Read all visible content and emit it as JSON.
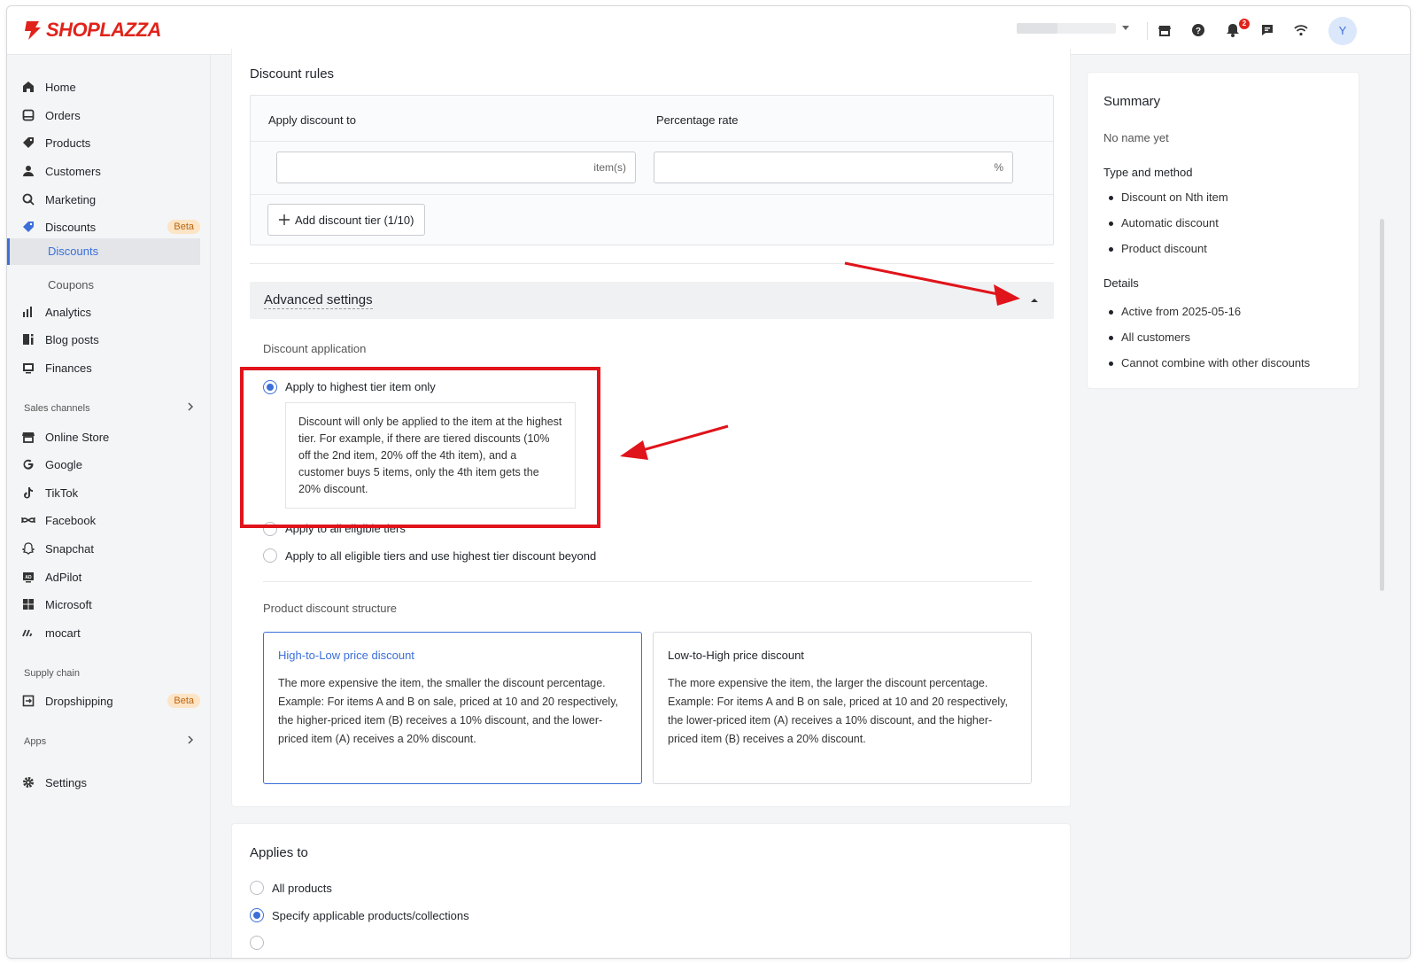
{
  "brand": {
    "name": "SHOPLAZZA",
    "color": "#e0231b",
    "accent": "#3c6fd9"
  },
  "topbar": {
    "notification_count": "2",
    "avatar_initial": "Y"
  },
  "sidebar": {
    "items": [
      {
        "label": "Home",
        "icon": "home-icon"
      },
      {
        "label": "Orders",
        "icon": "orders-icon"
      },
      {
        "label": "Products",
        "icon": "tag-icon"
      },
      {
        "label": "Customers",
        "icon": "person-icon"
      },
      {
        "label": "Marketing",
        "icon": "marketing-icon"
      },
      {
        "label": "Discounts",
        "icon": "discount-icon",
        "badge": "Beta"
      },
      {
        "label": "Analytics",
        "icon": "analytics-icon"
      },
      {
        "label": "Blog posts",
        "icon": "blog-icon"
      },
      {
        "label": "Finances",
        "icon": "finances-icon"
      }
    ],
    "sub_items": [
      "Discounts",
      "Coupons"
    ],
    "sales_channels_label": "Sales channels",
    "channels": [
      {
        "label": "Online Store",
        "icon": "store-icon"
      },
      {
        "label": "Google",
        "icon": "google-icon"
      },
      {
        "label": "TikTok",
        "icon": "tiktok-icon"
      },
      {
        "label": "Facebook",
        "icon": "facebook-icon"
      },
      {
        "label": "Snapchat",
        "icon": "snapchat-icon"
      },
      {
        "label": "AdPilot",
        "icon": "adpilot-icon"
      },
      {
        "label": "Microsoft",
        "icon": "microsoft-icon"
      },
      {
        "label": "mocart",
        "icon": "mocart-icon"
      }
    ],
    "supply_chain_label": "Supply chain",
    "dropshipping": {
      "label": "Dropshipping",
      "badge": "Beta"
    },
    "apps_label": "Apps",
    "settings_label": "Settings"
  },
  "discount_rules": {
    "title": "Discount rules",
    "col_apply": "Apply discount to",
    "col_rate": "Percentage rate",
    "items_suffix": "item(s)",
    "rate_suffix": "%",
    "add_tier_label": "Add discount tier (1/10)"
  },
  "advanced": {
    "title": "Advanced settings",
    "discount_application_label": "Discount application",
    "options": [
      {
        "label": "Apply to highest tier item only",
        "selected": true
      },
      {
        "label": "Apply to all eligible tiers",
        "selected": false
      },
      {
        "label": "Apply to all eligible tiers and use highest tier discount beyond",
        "selected": false
      }
    ],
    "selected_description": "Discount will only be applied to the item at the highest tier. For example, if there are tiered discounts (10% off the 2nd item, 20% off the 4th item), and a customer buys 5 items, only the 4th item gets the 20% discount.",
    "structure_label": "Product discount structure",
    "structures": [
      {
        "title": "High-to-Low price discount",
        "description": "The more expensive the item, the smaller the discount percentage.\nExample: For items A and B on sale, priced at 10 and 20 respectively, the higher-priced item (B) receives a 10% discount, and the lower-priced item (A) receives a 20% discount.",
        "selected": true
      },
      {
        "title": "Low-to-High price discount",
        "description": "The more expensive the item, the larger the discount percentage.\nExample: For items A and B on sale, priced at 10 and 20 respectively, the lower-priced item (A) receives a 10% discount, and the higher-priced item (B) receives a 20% discount.",
        "selected": false
      }
    ]
  },
  "applies_to": {
    "title": "Applies to",
    "options": [
      {
        "label": "All products",
        "selected": false
      },
      {
        "label": "Specify applicable products/collections",
        "selected": true
      }
    ]
  },
  "summary": {
    "title": "Summary",
    "name": "No name yet",
    "type_heading": "Type and method",
    "type_items": [
      "Discount on Nth item",
      "Automatic discount",
      "Product discount"
    ],
    "details_heading": "Details",
    "details_items": [
      "Active from 2025-05-16",
      "All customers",
      "Cannot combine with other discounts"
    ]
  }
}
